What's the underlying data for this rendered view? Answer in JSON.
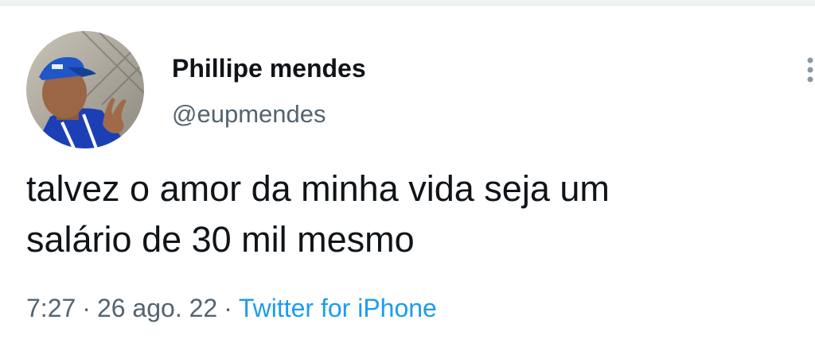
{
  "tweet": {
    "display_name": "Phillipe mendes",
    "handle": "@eupmendes",
    "text_lines": [
      "talvez o amor da minha vida seja um",
      "salário de 30 mil mesmo"
    ],
    "time": "7:27",
    "separator": "·",
    "date": "26 ago. 22",
    "source": "Twitter for iPhone"
  },
  "icons": {
    "avatar": "profile-photo",
    "more": "more-options-icon"
  },
  "colors": {
    "text_primary": "#0f1419",
    "text_secondary": "#536471",
    "accent": "#1d9bf0",
    "background": "#ffffff"
  }
}
